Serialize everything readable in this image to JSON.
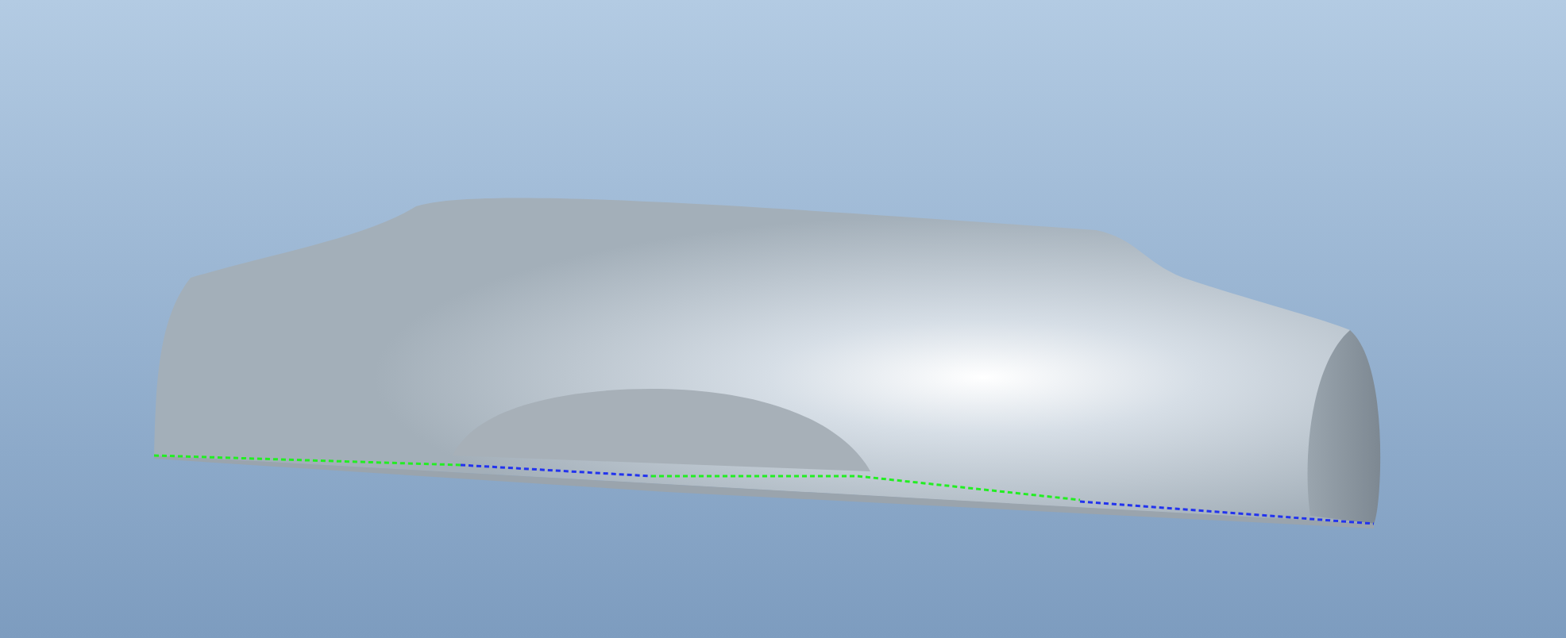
{
  "viewport": {
    "kind": "shaded-model"
  }
}
